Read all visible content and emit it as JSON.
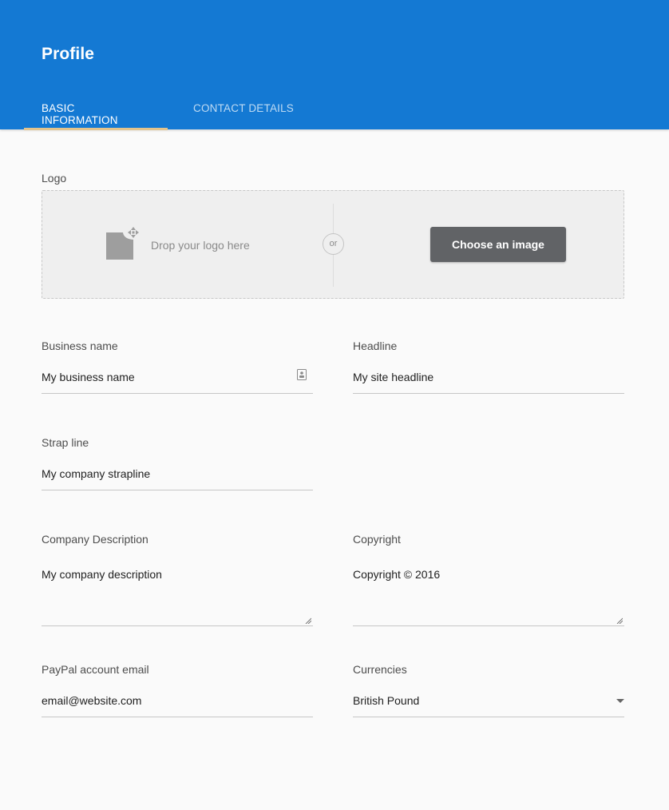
{
  "header": {
    "title": "Profile",
    "tabs": [
      {
        "label": "BASIC INFORMATION",
        "active": true
      },
      {
        "label": "CONTACT DETAILS",
        "active": false
      }
    ],
    "accent_color": "#1479d3",
    "tab_indicator_color": "#e3c48d"
  },
  "logo": {
    "label": "Logo",
    "drop_text": "Drop your logo here",
    "or_text": "or",
    "button_label": "Choose an image",
    "icon": "image-upload-icon"
  },
  "form": {
    "business_name": {
      "label": "Business name",
      "value": "My business name",
      "icon": "contact-card-icon"
    },
    "headline": {
      "label": "Headline",
      "value": "My site headline"
    },
    "strap_line": {
      "label": "Strap line",
      "value": "My company strapline"
    },
    "company_description": {
      "label": "Company Description",
      "value": "My company description"
    },
    "copyright": {
      "label": "Copyright",
      "value": "Copyright © 2016"
    },
    "paypal_email": {
      "label": "PayPal account email",
      "value": "email@website.com"
    },
    "currencies": {
      "label": "Currencies",
      "value": "British Pound",
      "icon": "dropdown-arrow-icon"
    }
  }
}
